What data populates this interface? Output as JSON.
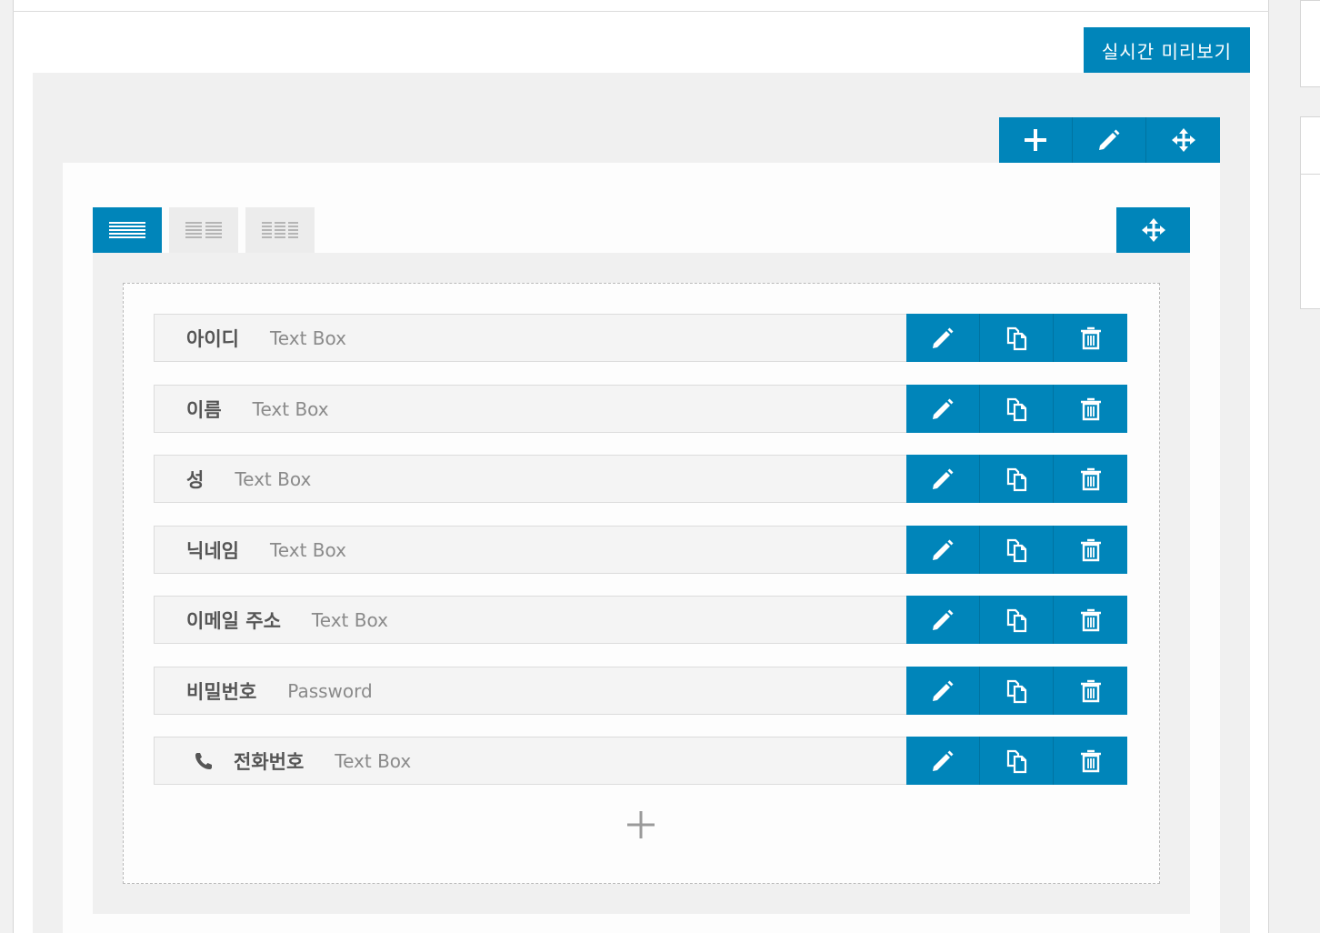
{
  "preview_button": {
    "label": "실시간 미리보기"
  },
  "section_toolbar": {
    "icons": [
      "plus-icon",
      "pencil-icon",
      "move-icon"
    ]
  },
  "row_tabs": {
    "icons": [
      "one-column-layout-icon",
      "two-column-layout-icon",
      "three-column-layout-icon"
    ],
    "active_index": 0
  },
  "row_move": {
    "icon": "move-icon"
  },
  "fields": [
    {
      "label": "아이디",
      "type": "Text Box"
    },
    {
      "label": "이름",
      "type": "Text Box"
    },
    {
      "label": "성",
      "type": "Text Box"
    },
    {
      "label": "닉네임",
      "type": "Text Box"
    },
    {
      "label": "이메일 주소",
      "type": "Text Box"
    },
    {
      "label": "비밀번호",
      "type": "Password"
    },
    {
      "label": "전화번호",
      "type": "Text Box",
      "icon": "phone-icon"
    }
  ],
  "field_actions": [
    "pencil-icon",
    "duplicate-icon",
    "trash-icon"
  ],
  "add_field": {
    "icon": "plus-icon"
  },
  "colors": {
    "accent": "#0085ba",
    "background": "#f0f0f0",
    "field_background": "#f4f4f4",
    "label_text": "#555555",
    "type_text": "#8a8a8a"
  }
}
